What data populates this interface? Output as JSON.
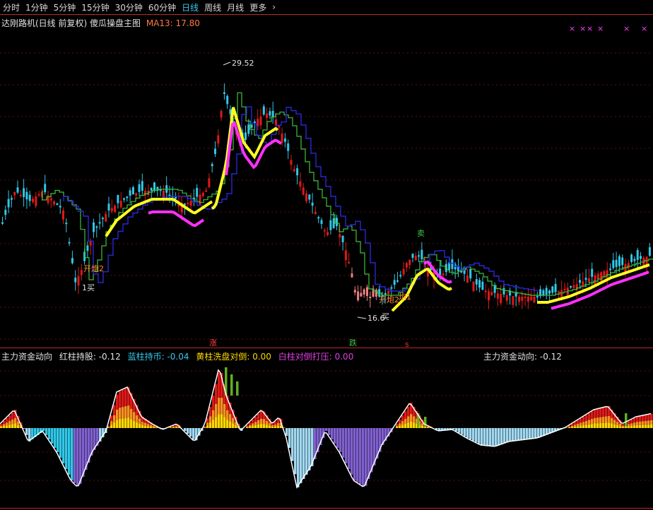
{
  "toolbar": {
    "tabs": [
      {
        "label": "分时",
        "active": false
      },
      {
        "label": "1分钟",
        "active": false
      },
      {
        "label": "5分钟",
        "active": false
      },
      {
        "label": "15分钟",
        "active": false
      },
      {
        "label": "30分钟",
        "active": false
      },
      {
        "label": "60分钟",
        "active": false
      },
      {
        "label": "日线",
        "active": true
      },
      {
        "label": "周线",
        "active": false
      },
      {
        "label": "月线",
        "active": false
      },
      {
        "label": "更多",
        "active": false
      }
    ],
    "more_arrow": "›"
  },
  "main_chart": {
    "title": "达刚路机(日线 前复权) 傻瓜操盘主图",
    "ma_label": "MA13: 17.80",
    "high_label": "29.52",
    "low_label": "16.6",
    "signals": {
      "buy1": "1买",
      "open2a": "开炮2",
      "open2b": "开炮2",
      "open1": "炮1",
      "buy_low": "买",
      "sell": "卖"
    },
    "markers": {
      "up": "涨",
      "down": "跌",
      "s": "s"
    }
  },
  "indicator": {
    "title": "主力资金动向",
    "items": [
      {
        "label": "红柱持股: -0.12",
        "color": "#e0e0e0"
      },
      {
        "label": "蓝柱持币: -0.04",
        "color": "#34c8f0"
      },
      {
        "label": "黄柱洗盘对倒: 0.00",
        "color": "#ffd700"
      },
      {
        "label": "白柱对倒打压: 0.00",
        "color": "#e040e0"
      }
    ],
    "right_label": "主力资金动向: -0.12"
  },
  "colors": {
    "up": "#e01818",
    "down": "#30c8e8",
    "ma_up": "#ffff20",
    "ma_dn": "#ff30ff",
    "green_line": "#40c040",
    "blue_line": "#2828d0",
    "grid": "#c0282a"
  }
}
